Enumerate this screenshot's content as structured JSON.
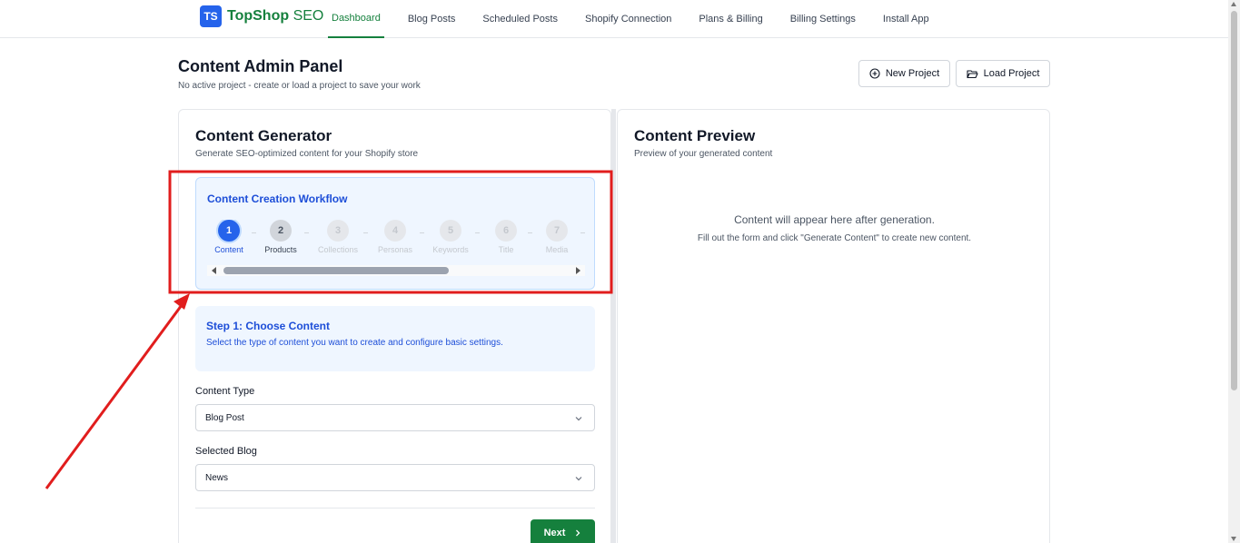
{
  "app": {
    "logo_initials": "TS",
    "brand_main": "TopShop",
    "brand_suffix": "SEO",
    "brand_color": "#15803d",
    "logo_color": "#2563eb"
  },
  "nav": {
    "items": [
      {
        "label": "Dashboard",
        "active": true
      },
      {
        "label": "Blog Posts",
        "active": false
      },
      {
        "label": "Scheduled Posts",
        "active": false
      },
      {
        "label": "Shopify Connection",
        "active": false
      },
      {
        "label": "Plans & Billing",
        "active": false
      },
      {
        "label": "Billing Settings",
        "active": false
      },
      {
        "label": "Install App",
        "active": false
      }
    ]
  },
  "header": {
    "title": "Content Admin Panel",
    "subtitle": "No active project - create or load a project to save your work",
    "new_project_label": "New Project",
    "load_project_label": "Load Project",
    "new_project_icon": "plus-circle-icon",
    "load_project_icon": "folder-open-icon"
  },
  "generator": {
    "title": "Content Generator",
    "subtitle": "Generate SEO-optimized content for your Shopify store",
    "workflow_title": "Content Creation Workflow",
    "steps": [
      {
        "num": "1",
        "label": "Content",
        "state": "current"
      },
      {
        "num": "2",
        "label": "Products",
        "state": "next"
      },
      {
        "num": "3",
        "label": "Collections",
        "state": "future"
      },
      {
        "num": "4",
        "label": "Personas",
        "state": "future"
      },
      {
        "num": "5",
        "label": "Keywords",
        "state": "future"
      },
      {
        "num": "6",
        "label": "Title",
        "state": "future"
      },
      {
        "num": "7",
        "label": "Media",
        "state": "future"
      }
    ],
    "step_info_title": "Step 1: Choose Content",
    "step_info_desc": "Select the type of content you want to create and configure basic settings.",
    "content_type_label": "Content Type",
    "content_type_value": "Blog Post",
    "selected_blog_label": "Selected Blog",
    "selected_blog_value": "News",
    "next_label": "Next",
    "accent_color": "#2563eb"
  },
  "preview": {
    "title": "Content Preview",
    "subtitle": "Preview of your generated content",
    "empty_line1": "Content will appear here after generation.",
    "empty_line2": "Fill out the form and click \"Generate Content\" to create new content."
  },
  "annotation": {
    "color": "#e11d1d"
  }
}
